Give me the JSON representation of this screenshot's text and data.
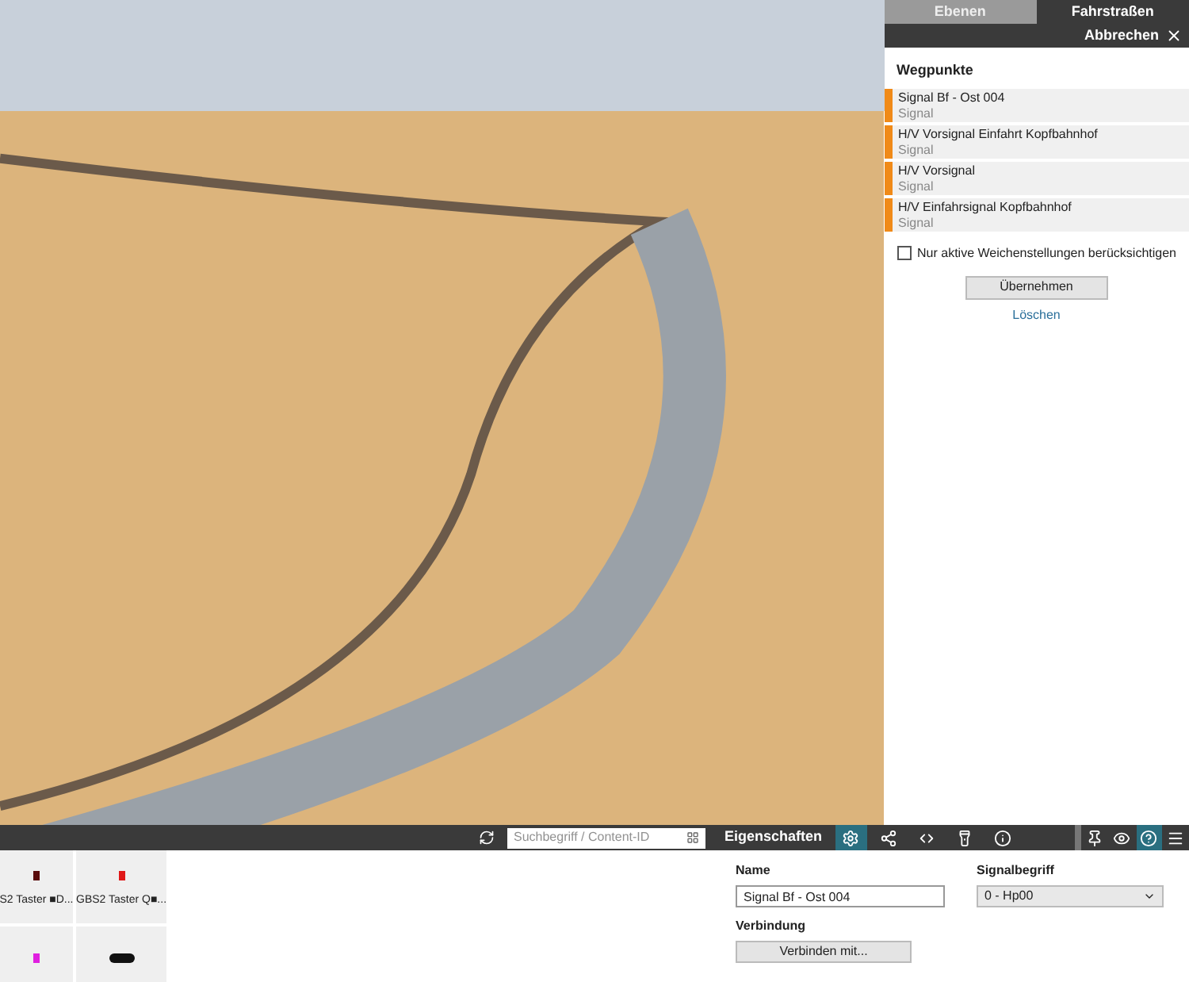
{
  "panel_tabs": [
    {
      "label": "Ebenen",
      "selected": false
    },
    {
      "label": "Fahrstraßen",
      "selected": true
    }
  ],
  "cancel": {
    "label": "Abbrechen"
  },
  "waypoints": {
    "title": "Wegpunkte",
    "items": [
      {
        "name": "Signal Bf - Ost 004",
        "type": "Signal",
        "color": "#f08a18"
      },
      {
        "name": "H/V Vorsignal Einfahrt Kopfbahnhof",
        "type": "Signal",
        "color": "#f08a18"
      },
      {
        "name": "H/V Vorsignal",
        "type": "Signal",
        "color": "#f08a18"
      },
      {
        "name": "H/V Einfahrsignal Kopfbahnhof",
        "type": "Signal",
        "color": "#f08a18"
      }
    ]
  },
  "only_active": {
    "label": "Nur aktive Weichenstellungen berücksichtigen",
    "checked": false
  },
  "apply_button": "Übernehmen",
  "delete_link": "Löschen",
  "search": {
    "placeholder": "Suchbegriff / Content-ID"
  },
  "content_tiles": [
    {
      "label": "S2 Taster ■D...",
      "color": "#5a0c0c"
    },
    {
      "label": "GBS2 Taster Q■...",
      "color": "#e01818"
    },
    {
      "color": "#e020e0"
    },
    {
      "color": "#111111"
    }
  ],
  "properties": {
    "title": "Eigenschaften",
    "tool_tabs": [
      {
        "kind": "gear",
        "selected": true
      },
      {
        "kind": "nodes",
        "selected": false
      },
      {
        "kind": "arrows",
        "selected": false
      },
      {
        "kind": "flashlight",
        "selected": false
      },
      {
        "kind": "info",
        "selected": false
      }
    ],
    "view_tools": [
      {
        "kind": "pin",
        "selected": false
      },
      {
        "kind": "eye",
        "selected": false
      },
      {
        "kind": "help",
        "selected": true
      },
      {
        "kind": "menu",
        "selected": false
      }
    ],
    "name_label": "Name",
    "name_value": "Signal Bf - Ost 004",
    "signal_label": "Signalbegriff",
    "signal_value": "0 - Hp00",
    "connection_label": "Verbindung",
    "connect_button": "Verbinden mit..."
  }
}
